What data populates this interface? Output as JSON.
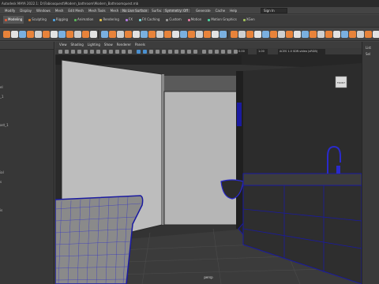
{
  "window": {
    "title": "Autodesk MAYA 2022.1: D:\\Fabiooquest\\Modern_bathroom\\Modern_Bathroomquest.mb"
  },
  "menubar": {
    "items": [
      "Modify",
      "Display",
      "Windows",
      "Mesh",
      "Edit Mesh",
      "Mesh Tools",
      "Mesh Display",
      "Curves",
      "Surfaces",
      "Deform",
      "UV",
      "Generate",
      "Cache",
      "Help"
    ],
    "live_surface": "No Live Surface",
    "symmetry": "Symmetry: Off",
    "sign_in": "Sign In"
  },
  "shelf_tabs": [
    {
      "label": "Modeling",
      "color": "#e05a3a",
      "active": true
    },
    {
      "label": "Sculpting",
      "color": "#d07a2e",
      "active": false
    },
    {
      "label": "Rigging",
      "color": "#4fa3e0",
      "active": false
    },
    {
      "label": "Animation",
      "color": "#5ab55a",
      "active": false
    },
    {
      "label": "Rendering",
      "color": "#e0c04a",
      "active": false
    },
    {
      "label": "FX",
      "color": "#b07ae0",
      "active": false
    },
    {
      "label": "FX Caching",
      "color": "#7ad0d0",
      "active": false
    },
    {
      "label": "Custom",
      "color": "#999999",
      "active": false
    },
    {
      "label": "Motion",
      "color": "#e07aa0",
      "active": false
    },
    {
      "label": "Motion Graphics",
      "color": "#4ad0a0",
      "active": false
    },
    {
      "label": "XGen",
      "color": "#a0c05a",
      "active": false
    }
  ],
  "outliner": {
    "rows": [
      "el",
      "_1",
      "",
      "",
      "ast_1",
      "",
      "",
      "",
      "",
      "ial",
      "s",
      "",
      "",
      "is"
    ]
  },
  "viewport": {
    "menu": [
      "View",
      "Shading",
      "Lighting",
      "Show",
      "Renderer",
      "Panels"
    ],
    "exposure": "0.00",
    "gamma": "1.00",
    "color_space": "ACES 1.0 SDR-video (sRGB)",
    "camera_label": "persp",
    "view_cube": "FRONT"
  },
  "rightbar": {
    "labels": [
      "List",
      "Sel"
    ]
  },
  "colors": {
    "accent_blue": "#1a1aa0",
    "wire": "#2a2acc",
    "shelf_orange": "#e8833a"
  }
}
